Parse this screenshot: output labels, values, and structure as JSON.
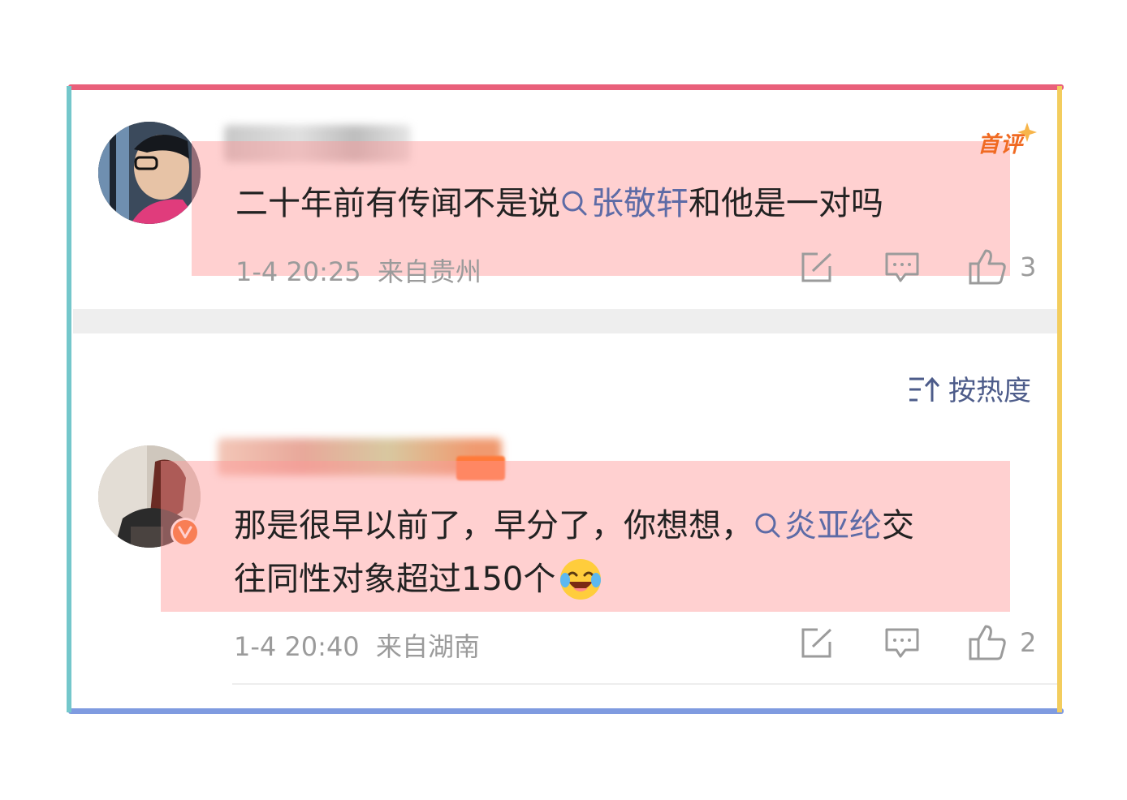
{
  "comments": [
    {
      "text_before": "二十年前有传闻不是说",
      "topic": "张敬轩",
      "text_after": "和他是一对吗",
      "time": "1-4 20:25",
      "location": "来自贵州",
      "badge": "首评",
      "likes": "3"
    },
    {
      "line1_before": "那是很早以前了，早分了，你想想，",
      "topic": "炎亚纶",
      "line1_after": "交",
      "line2": "往同性对象超过150个",
      "emoji": "laughing-tears-emoji",
      "time": "1-4 20:40",
      "location": "来自湖南",
      "likes": "2"
    }
  ],
  "sort": {
    "label": "按热度"
  },
  "colors": {
    "topic": "#5d6ba6",
    "badge": "#f06a22",
    "meta": "#9b9b9b",
    "highlight": "rgba(255,150,150,0.45)"
  }
}
